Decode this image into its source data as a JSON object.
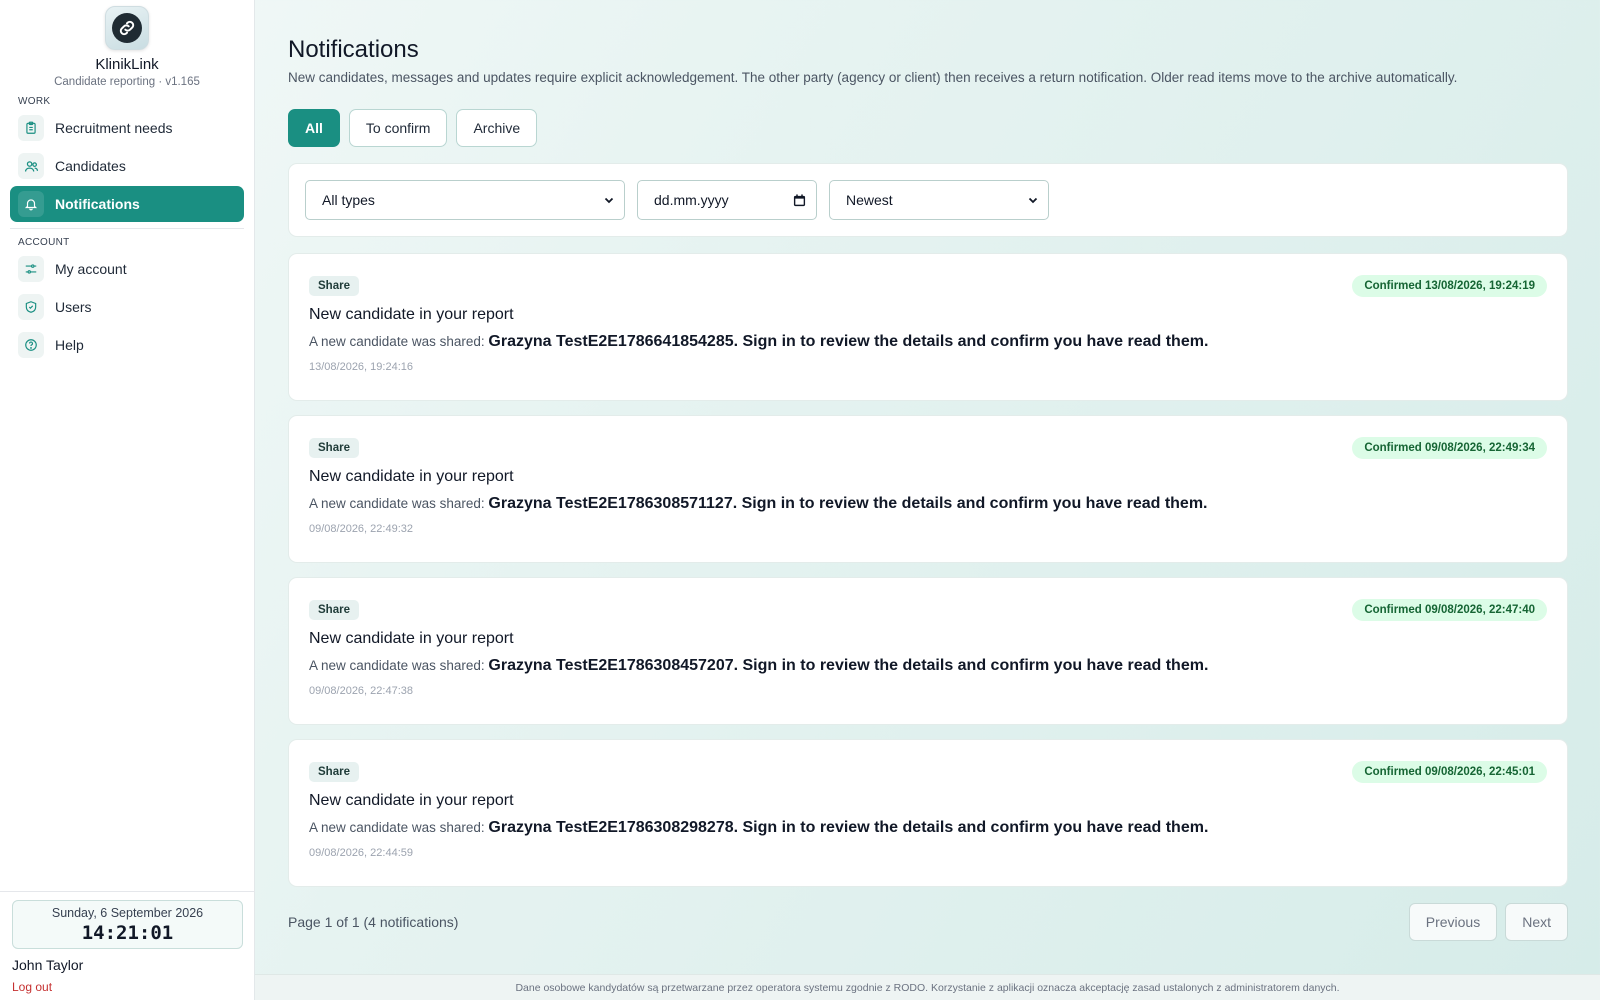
{
  "brand": {
    "name": "KlinikLink",
    "subtitle": "Candidate reporting · v1.165"
  },
  "sidebar": {
    "work_label": "WORK",
    "account_label": "ACCOUNT",
    "work_items": [
      {
        "label": "Recruitment needs",
        "icon": "clipboard-icon"
      },
      {
        "label": "Candidates",
        "icon": "users-icon"
      },
      {
        "label": "Notifications",
        "icon": "bell-icon",
        "active": true
      }
    ],
    "account_items": [
      {
        "label": "My account",
        "icon": "sliders-icon"
      },
      {
        "label": "Users",
        "icon": "shield-icon"
      },
      {
        "label": "Help",
        "icon": "help-circle-icon"
      }
    ],
    "clock_date": "Sunday, 6 September 2026",
    "clock_time": "14:21:01",
    "user_name": "John Taylor",
    "logout_label": "Log out"
  },
  "main": {
    "title": "Notifications",
    "description": "New candidates, messages and updates require explicit acknowledgement. The other party (agency or client) then receives a return notification. Older read items move to the archive automatically.",
    "tabs": [
      "All",
      "To confirm",
      "Archive"
    ],
    "active_tab": "All",
    "filters": {
      "type_value": "All types",
      "date_placeholder": "dd.mm.yyyy",
      "sort_value": "Newest"
    },
    "notifications": [
      {
        "type": "Share",
        "status": "Confirmed 13/08/2026, 19:24:19",
        "title": "New candidate in your report",
        "prefix": "A new candidate was shared:",
        "message": "Grazyna TestE2E1786641854285. Sign in to review the details and confirm you have read them.",
        "time": "13/08/2026, 19:24:16"
      },
      {
        "type": "Share",
        "status": "Confirmed 09/08/2026, 22:49:34",
        "title": "New candidate in your report",
        "prefix": "A new candidate was shared:",
        "message": "Grazyna TestE2E1786308571127. Sign in to review the details and confirm you have read them.",
        "time": "09/08/2026, 22:49:32"
      },
      {
        "type": "Share",
        "status": "Confirmed 09/08/2026, 22:47:40",
        "title": "New candidate in your report",
        "prefix": "A new candidate was shared:",
        "message": "Grazyna TestE2E1786308457207. Sign in to review the details and confirm you have read them.",
        "time": "09/08/2026, 22:47:38"
      },
      {
        "type": "Share",
        "status": "Confirmed 09/08/2026, 22:45:01",
        "title": "New candidate in your report",
        "prefix": "A new candidate was shared:",
        "message": "Grazyna TestE2E1786308298278. Sign in to review the details and confirm you have read them.",
        "time": "09/08/2026, 22:44:59"
      }
    ],
    "pagination": {
      "info": "Page 1 of 1 (4 notifications)",
      "previous": "Previous",
      "next": "Next"
    }
  },
  "footer": "Dane osobowe kandydatów są przetwarzane przez operatora systemu zgodnie z RODO. Korzystanie z aplikacji oznacza akceptację zasad ustalonych z administratorem danych.",
  "colors": {
    "accent": "#1a8f82",
    "confirmed_bg": "#dcfce7",
    "confirmed_text": "#166534"
  }
}
